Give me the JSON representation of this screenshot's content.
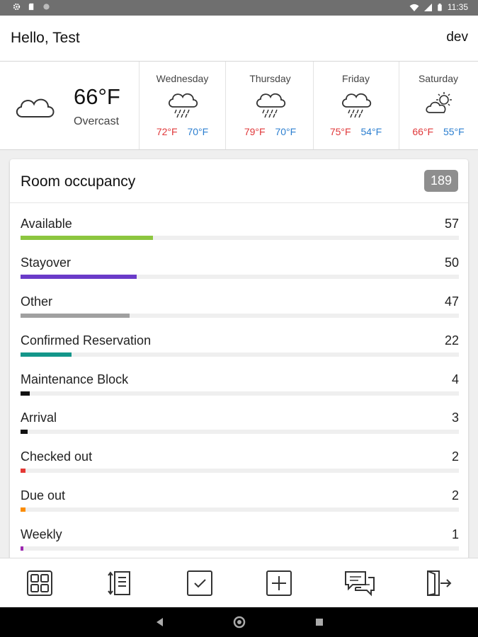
{
  "status_bar": {
    "time": "11:35",
    "left_icons": [
      "settings-icon",
      "sd-card-icon",
      "circle-icon"
    ],
    "right_icons": [
      "wifi-icon",
      "signal-icon",
      "battery-icon"
    ]
  },
  "header": {
    "greeting": "Hello, Test",
    "environment": "dev"
  },
  "weather": {
    "current": {
      "temp": "66°F",
      "condition": "Overcast",
      "icon": "cloud-icon"
    },
    "forecast": [
      {
        "day": "Wednesday",
        "high": "72°F",
        "low": "70°F",
        "icon": "rain-cloud-icon"
      },
      {
        "day": "Thursday",
        "high": "79°F",
        "low": "70°F",
        "icon": "rain-cloud-icon"
      },
      {
        "day": "Friday",
        "high": "75°F",
        "low": "54°F",
        "icon": "rain-cloud-icon"
      },
      {
        "day": "Saturday",
        "high": "66°F",
        "low": "55°F",
        "icon": "partly-sunny-icon"
      }
    ],
    "colors": {
      "high": "#e0383a",
      "low": "#2c7fd0"
    }
  },
  "occupancy": {
    "title": "Room occupancy",
    "total": "189",
    "items": [
      {
        "label": "Available",
        "count": "57",
        "value": 57,
        "color": "#8cc63f"
      },
      {
        "label": "Stayover",
        "count": "50",
        "value": 50,
        "color": "#6a3bc9"
      },
      {
        "label": "Other",
        "count": "47",
        "value": 47,
        "color": "#a0a0a0"
      },
      {
        "label": "Confirmed Reservation",
        "count": "22",
        "value": 22,
        "color": "#14968a"
      },
      {
        "label": "Maintenance Block",
        "count": "4",
        "value": 4,
        "color": "#111111"
      },
      {
        "label": "Arrival",
        "count": "3",
        "value": 3,
        "color": "#111111"
      },
      {
        "label": "Checked out",
        "count": "2",
        "value": 2,
        "color": "#e53935"
      },
      {
        "label": "Due out",
        "count": "2",
        "value": 2,
        "color": "#fb8c00"
      },
      {
        "label": "Weekly",
        "count": "1",
        "value": 1,
        "color": "#9c27b0"
      }
    ]
  },
  "bottom_nav": [
    "dashboard-icon",
    "room-list-icon",
    "tasks-check-icon",
    "add-icon",
    "messages-icon",
    "logout-icon"
  ],
  "system_nav": [
    "back-icon",
    "home-icon",
    "recents-icon"
  ]
}
